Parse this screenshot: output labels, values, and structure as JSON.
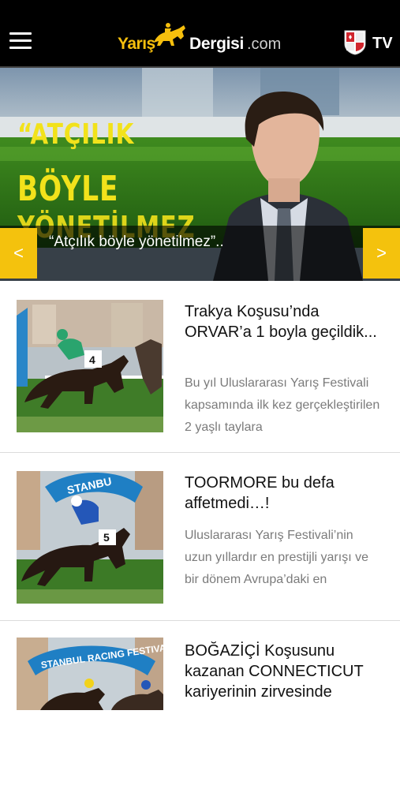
{
  "header": {
    "logo": {
      "part1": "Yarış",
      "part2": "Dergisi",
      "part3": ".com"
    },
    "tv_label": "TV"
  },
  "hero": {
    "slogan_line1": "“ATÇILIK",
    "slogan_line2": "BÖYLE",
    "slogan_line3": "YÖNETİLMEZ",
    "caption": "“Atçılık böyle yönetilmez”..",
    "prev_label": "<",
    "next_label": ">"
  },
  "articles": [
    {
      "title": "Trakya Koşusu’nda ORVAR’a 1 boyla geçildik...",
      "desc": "Bu yıl Uluslararası Yarış Festivali kapsamında ilk kez gerçekleştirilen 2 yaşlı taylara"
    },
    {
      "title": "TOORMORE bu defa affetmedi…!",
      "desc": "Uluslararası Yarış Festivali’nin uzun yıllardır en prestijli yarışı ve bir dönem Avrupa’daki en"
    },
    {
      "title": "BOĞAZİÇİ Koşusunu kazanan CONNECTICUT kariyerinin zirvesinde",
      "desc": ""
    }
  ],
  "thumb_text": {
    "saddle_1": "4",
    "saddle_2": "5",
    "banner_2": "STANBU",
    "banner_3": "STANBUL RACING FESTIVAL"
  },
  "colors": {
    "brand_yellow": "#f4c20d",
    "header_bg": "#000000",
    "desc_gray": "#7b7b7b"
  }
}
